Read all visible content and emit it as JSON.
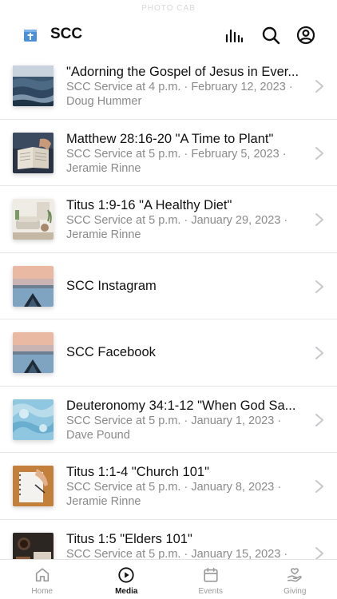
{
  "status_bar": {
    "text": "PHOTO CAB"
  },
  "header": {
    "title": "SCC",
    "logo_icon": "bible-logo-icon",
    "actions": [
      "audio-bars-icon",
      "search-icon",
      "account-icon"
    ]
  },
  "colors": {
    "accent": "#4a90d9",
    "text": "#111111",
    "secondary": "#8a8a8a",
    "divider": "#e6e6e6"
  },
  "items": [
    {
      "title": "\"Adorning the Gospel of Jesus in Ever...",
      "subtitle": "SCC Service at 4 p.m. · February 12, 2023 ·",
      "speaker": "Doug Hummer",
      "thumbnail": "ocean-waves"
    },
    {
      "title": "Matthew 28:16-20 \"A Time to Plant\"",
      "subtitle": "SCC Service at 5 p.m. · February 5, 2023 ·",
      "speaker": "Jeramie Rinne",
      "thumbnail": "open-bible"
    },
    {
      "title": "Titus 1:9-16 \"A Healthy Diet\"",
      "subtitle": "SCC Service at 5 p.m. · January 29, 2023 ·",
      "speaker": "Jeramie Rinne",
      "thumbnail": "living-room"
    },
    {
      "title": "SCC Instagram",
      "subtitle": "",
      "speaker": "",
      "thumbnail": "kayak-lake"
    },
    {
      "title": "SCC Facebook",
      "subtitle": "",
      "speaker": "",
      "thumbnail": "kayak-lake"
    },
    {
      "title": "Deuteronomy 34:1-12 \"When God Sa...",
      "subtitle": "SCC Service at 5 p.m. · January 1, 2023 ·",
      "speaker": "Dave Pound",
      "thumbnail": "blue-water"
    },
    {
      "title": "Titus 1:1-4 \"Church 101\"",
      "subtitle": "SCC Service at 5 p.m. · January 8, 2023 ·",
      "speaker": "Jeramie Rinne",
      "thumbnail": "notebook-writing"
    },
    {
      "title": "Titus 1:5 \"Elders 101\"",
      "subtitle": "SCC Service at 5 p.m. · January 15, 2023 ·",
      "speaker": "",
      "thumbnail": "desk-coffee"
    }
  ],
  "tabs": [
    {
      "label": "Home",
      "icon": "home-icon",
      "active": false
    },
    {
      "label": "Media",
      "icon": "play-circle-icon",
      "active": true
    },
    {
      "label": "Events",
      "icon": "calendar-icon",
      "active": false
    },
    {
      "label": "Giving",
      "icon": "giving-hand-icon",
      "active": false
    }
  ]
}
